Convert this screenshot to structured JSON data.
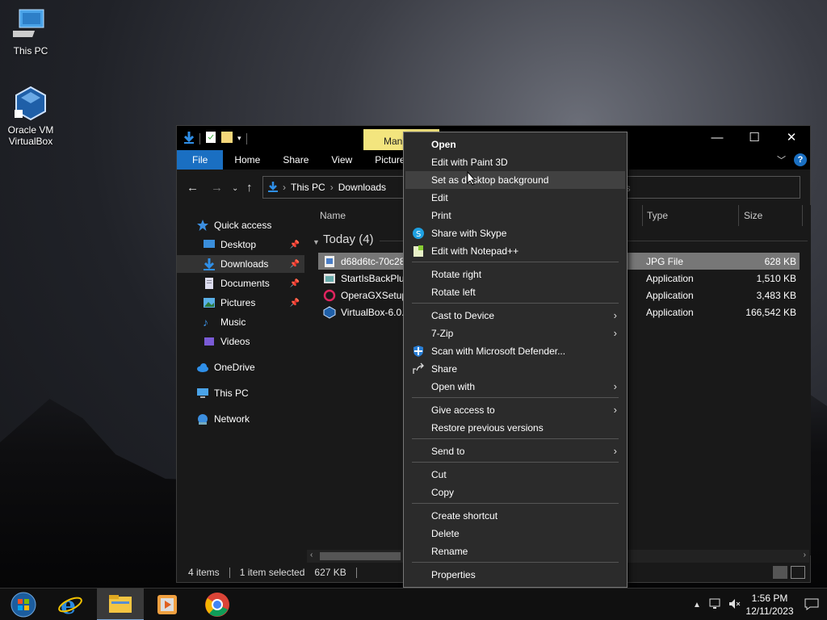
{
  "desktop": {
    "icons": [
      {
        "label": "This PC"
      },
      {
        "label": "Oracle VM VirtualBox"
      }
    ]
  },
  "explorer": {
    "manage_tab": "Mana",
    "window_controls": [
      "—",
      "☐",
      "✕"
    ],
    "ribbon_tabs": [
      "File",
      "Home",
      "Share",
      "View",
      "Picture"
    ],
    "address": {
      "segments": [
        "This PC",
        "Downloads"
      ]
    },
    "search_placeholder": "ds",
    "sidebar": [
      {
        "label": "Quick access",
        "icon": "star-icon",
        "color": "#3c8fe0"
      },
      {
        "label": "Desktop",
        "icon": "desktop-icon",
        "pinned": true
      },
      {
        "label": "Downloads",
        "icon": "download-icon",
        "pinned": true,
        "selected": true
      },
      {
        "label": "Documents",
        "icon": "document-icon",
        "pinned": true
      },
      {
        "label": "Pictures",
        "icon": "picture-icon",
        "pinned": true
      },
      {
        "label": "Music",
        "icon": "music-icon"
      },
      {
        "label": "Videos",
        "icon": "video-icon"
      },
      {
        "label": "OneDrive",
        "icon": "cloud-icon"
      },
      {
        "label": "This PC",
        "icon": "computer-icon"
      },
      {
        "label": "Network",
        "icon": "network-icon"
      }
    ],
    "columns": {
      "name": "Name",
      "type": "Type",
      "size": "Size"
    },
    "group": "Today (4)",
    "files": [
      {
        "name": "d68d6tc-70c283",
        "type": "JPG File",
        "size": "628 KB",
        "selected": true
      },
      {
        "name": "StartIsBackPlusF",
        "type": "Application",
        "size": "1,510 KB"
      },
      {
        "name": "OperaGXSetup",
        "type": "Application",
        "size": "3,483 KB"
      },
      {
        "name": "VirtualBox-6.0.2",
        "type": "Application",
        "size": "166,542 KB"
      }
    ],
    "status": {
      "items": "4 items",
      "selected": "1 item selected",
      "size": "627 KB"
    }
  },
  "context_menu": [
    {
      "label": "Open",
      "bold": true
    },
    {
      "label": "Edit with Paint 3D"
    },
    {
      "label": "Set as desktop background",
      "hover": true
    },
    {
      "label": "Edit"
    },
    {
      "label": "Print"
    },
    {
      "label": "Share with Skype",
      "icon": "skype-icon"
    },
    {
      "label": "Edit with Notepad++",
      "icon": "notepadpp-icon"
    },
    {
      "sep": true
    },
    {
      "label": "Rotate right"
    },
    {
      "label": "Rotate left"
    },
    {
      "sep": true
    },
    {
      "label": "Cast to Device",
      "submenu": true
    },
    {
      "label": "7-Zip",
      "submenu": true
    },
    {
      "label": "Scan with Microsoft Defender...",
      "icon": "defender-icon"
    },
    {
      "label": "Share",
      "icon": "share-icon"
    },
    {
      "label": "Open with",
      "submenu": true
    },
    {
      "sep": true
    },
    {
      "label": "Give access to",
      "submenu": true
    },
    {
      "label": "Restore previous versions"
    },
    {
      "sep": true
    },
    {
      "label": "Send to",
      "submenu": true
    },
    {
      "sep": true
    },
    {
      "label": "Cut"
    },
    {
      "label": "Copy"
    },
    {
      "sep": true
    },
    {
      "label": "Create shortcut"
    },
    {
      "label": "Delete"
    },
    {
      "label": "Rename"
    },
    {
      "sep": true
    },
    {
      "label": "Properties"
    }
  ],
  "taskbar": {
    "clock": {
      "time": "1:56 PM",
      "date": "12/11/2023"
    }
  }
}
